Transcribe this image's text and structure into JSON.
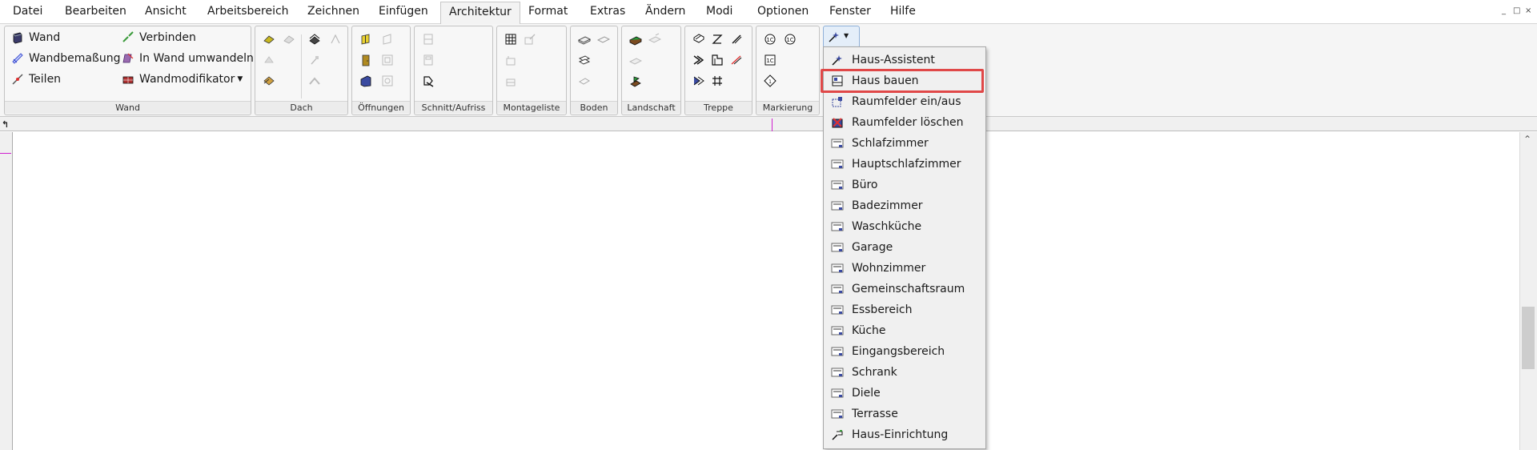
{
  "menubar": {
    "items": [
      "Datei",
      "Bearbeiten",
      "Ansicht",
      "Arbeitsbereich",
      "Zeichnen",
      "Einfügen",
      "Architektur",
      "Format",
      "Extras",
      "Ändern",
      "Modi",
      "Optionen",
      "Fenster",
      "Hilfe"
    ],
    "active": "Architektur",
    "window_controls": [
      "_",
      "□",
      "×"
    ]
  },
  "ribbon": {
    "wall": {
      "label": "Wand",
      "wand": "Wand",
      "wandbemassung": "Wandbemaßung",
      "teilen": "Teilen",
      "verbinden": "Verbinden",
      "in_wand_umwandeln": "In Wand umwandeln",
      "wandmodifikator": "Wandmodifikator"
    },
    "groups": {
      "dach": "Dach",
      "oeffnungen": "Öffnungen",
      "schnitt": "Schnitt/Aufriss",
      "montageliste": "Montageliste",
      "boden": "Boden",
      "landschaft": "Landschaft",
      "treppe": "Treppe",
      "markierung": "Markierung"
    }
  },
  "dropdown": {
    "items": [
      "Haus-Assistent",
      "Haus bauen",
      "Raumfelder ein/aus",
      "Raumfelder löschen",
      "Schlafzimmer",
      "Hauptschlafzimmer",
      "Büro",
      "Badezimmer",
      "Waschküche",
      "Garage",
      "Wohnzimmer",
      "Gemeinschaftsraum",
      "Essbereich",
      "Küche",
      "Eingangsbereich",
      "Schrank",
      "Diele",
      "Terrasse",
      "Haus-Einrichtung"
    ],
    "highlighted": "Haus bauen"
  },
  "colors": {
    "highlight": "#e04848",
    "accent_magenta": "#d020d0"
  },
  "icons": {
    "corner": "L-arrow-icon",
    "scroll_up": "chevron-up-icon"
  }
}
